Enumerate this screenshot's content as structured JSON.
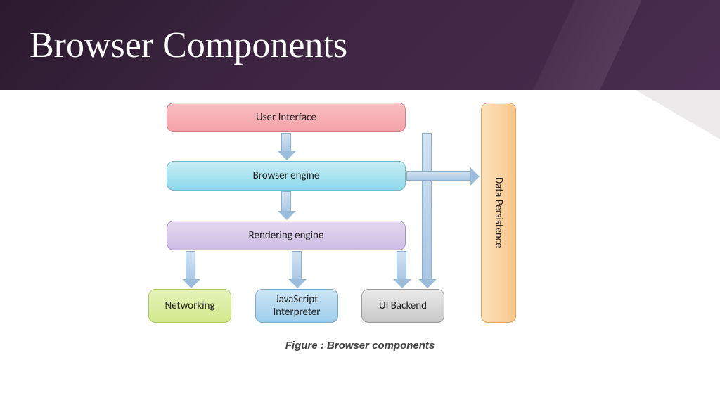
{
  "slide": {
    "title": "Browser Components"
  },
  "diagram": {
    "boxes": {
      "ui": "User  Interface",
      "browser_engine": "Browser engine",
      "rendering_engine": "Rendering engine",
      "networking": "Networking",
      "js_interpreter": "JavaScript\nInterpreter",
      "ui_backend": "UI Backend",
      "data_persistence": "Data Persistence"
    },
    "caption": "Figure : Browser components",
    "arrows": [
      {
        "from": "ui",
        "to": "browser_engine"
      },
      {
        "from": "browser_engine",
        "to": "rendering_engine"
      },
      {
        "from": "rendering_engine",
        "to": "networking"
      },
      {
        "from": "rendering_engine",
        "to": "js_interpreter"
      },
      {
        "from": "rendering_engine",
        "to": "ui_backend"
      },
      {
        "from": "ui",
        "to": "ui_backend"
      },
      {
        "from": "browser_engine",
        "to": "data_persistence"
      }
    ],
    "colors": {
      "ui": "#f4a2a8",
      "browser_engine": "#8dd9eb",
      "rendering_engine": "#cdbde4",
      "networking": "#d2e88a",
      "js_interpreter": "#9fcdeb",
      "ui_backend": "#c8c8c8",
      "data_persistence": "#f9c78a",
      "arrow": "#a9c7e4"
    }
  }
}
